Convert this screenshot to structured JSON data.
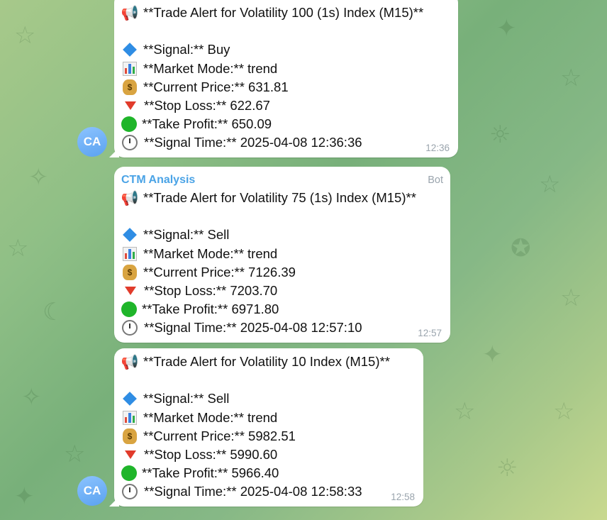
{
  "messages": [
    {
      "sender": "",
      "bot_label": "",
      "lines": [
        {
          "icon": "megaphone-icon",
          "text": "**Trade Alert for Volatility 100 (1s) Index (M15)**"
        },
        {
          "icon": "",
          "text": ""
        },
        {
          "icon": "blue-diamond-icon",
          "text": "**Signal:** Buy"
        },
        {
          "icon": "bar-chart-icon",
          "text": "**Market Mode:** trend"
        },
        {
          "icon": "money-bag-icon",
          "text": "**Current Price:** 631.81"
        },
        {
          "icon": "red-triangle-down-icon",
          "text": "**Stop Loss:** 622.67"
        },
        {
          "icon": "green-circle-icon",
          "text": "**Take Profit:** 650.09"
        },
        {
          "icon": "stopwatch-icon",
          "text": "**Signal Time:** 2025-04-08 12:36:36"
        }
      ],
      "time": "12:36",
      "avatar": "CA"
    },
    {
      "sender": "CTM Analysis",
      "bot_label": "Bot",
      "lines": [
        {
          "icon": "megaphone-icon",
          "text": "**Trade Alert for Volatility 75 (1s) Index (M15)**"
        },
        {
          "icon": "",
          "text": ""
        },
        {
          "icon": "blue-diamond-icon",
          "text": "**Signal:** Sell"
        },
        {
          "icon": "bar-chart-icon",
          "text": "**Market Mode:** trend"
        },
        {
          "icon": "money-bag-icon",
          "text": "**Current Price:** 7126.39"
        },
        {
          "icon": "red-triangle-down-icon",
          "text": "**Stop Loss:** 7203.70"
        },
        {
          "icon": "green-circle-icon",
          "text": "**Take Profit:** 6971.80"
        },
        {
          "icon": "stopwatch-icon",
          "text": "**Signal Time:** 2025-04-08 12:57:10"
        }
      ],
      "time": "12:57",
      "avatar": ""
    },
    {
      "sender": "",
      "bot_label": "",
      "lines": [
        {
          "icon": "megaphone-icon",
          "text": "**Trade Alert for Volatility 10 Index (M15)**"
        },
        {
          "icon": "",
          "text": ""
        },
        {
          "icon": "blue-diamond-icon",
          "text": "**Signal:** Sell"
        },
        {
          "icon": "bar-chart-icon",
          "text": "**Market Mode:** trend"
        },
        {
          "icon": "money-bag-icon",
          "text": "**Current Price:** 5982.51"
        },
        {
          "icon": "red-triangle-down-icon",
          "text": "**Stop Loss:** 5990.60"
        },
        {
          "icon": "green-circle-icon",
          "text": "**Take Profit:** 5966.40"
        },
        {
          "icon": "stopwatch-icon",
          "text": "**Signal Time:** 2025-04-08 12:58:33"
        }
      ],
      "time": "12:58",
      "avatar": "CA"
    }
  ],
  "colors": {
    "sender_name": "#4aa3e6",
    "avatar": "#6aaff5",
    "bubble": "#ffffff",
    "timestamp": "#9aa4ad"
  }
}
